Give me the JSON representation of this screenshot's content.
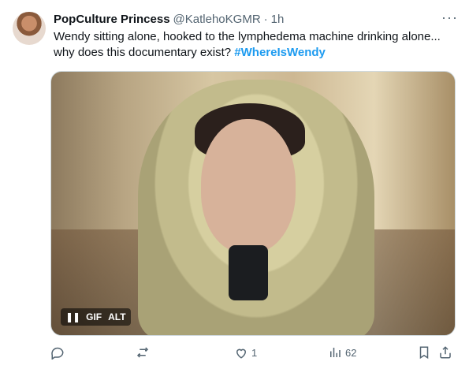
{
  "tweet": {
    "author": {
      "display_name": "PopCulture Princess",
      "handle": "@KatlehoKGMR",
      "time": "1h"
    },
    "text_plain": "Wendy sitting alone, hooked to the lymphedema machine drinking alone... why does this documentary exist? ",
    "hashtag": "#WhereIsWendy",
    "media": {
      "badge_gif": "GIF",
      "badge_alt": "ALT"
    },
    "actions": {
      "reply_count": "",
      "retweet_count": "",
      "like_count": "1",
      "views_count": "62"
    }
  },
  "icons": {
    "more": "more-icon",
    "reply": "reply-icon",
    "retweet": "retweet-icon",
    "like": "like-icon",
    "views": "views-icon",
    "bookmark": "bookmark-icon",
    "share": "share-icon",
    "pause": "pause-icon"
  },
  "colors": {
    "link": "#1d9bf0",
    "text": "#0f1419",
    "secondary": "#536471"
  }
}
